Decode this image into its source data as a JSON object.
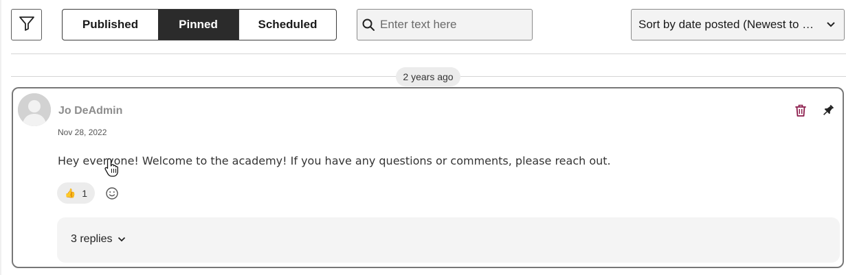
{
  "toolbar": {
    "tabs": [
      {
        "label": "Published",
        "active": false
      },
      {
        "label": "Pinned",
        "active": true
      },
      {
        "label": "Scheduled",
        "active": false
      }
    ],
    "search": {
      "placeholder": "Enter text here",
      "value": ""
    },
    "sort": {
      "selected": "Sort by date posted (Newest to oldest)"
    }
  },
  "timeline": {
    "date_divider": "2 years ago"
  },
  "post": {
    "author": "Jo DeAdmin",
    "date": "Nov 28, 2022",
    "text": "Hey everyone! Welcome to the academy! If you have any questions or comments, please reach out.",
    "reaction": {
      "emoji": "👍",
      "count": "1"
    },
    "replies_label": "3 replies"
  },
  "colors": {
    "active_tab_bg": "#2b2b2b",
    "trash_icon": "#8b1a4a",
    "pin_icon": "#222222"
  },
  "icons": [
    "filter-icon",
    "search-icon",
    "chevron-down-icon",
    "avatar-placeholder",
    "trash-icon",
    "pin-icon",
    "smiley-add-icon",
    "hand-cursor"
  ]
}
